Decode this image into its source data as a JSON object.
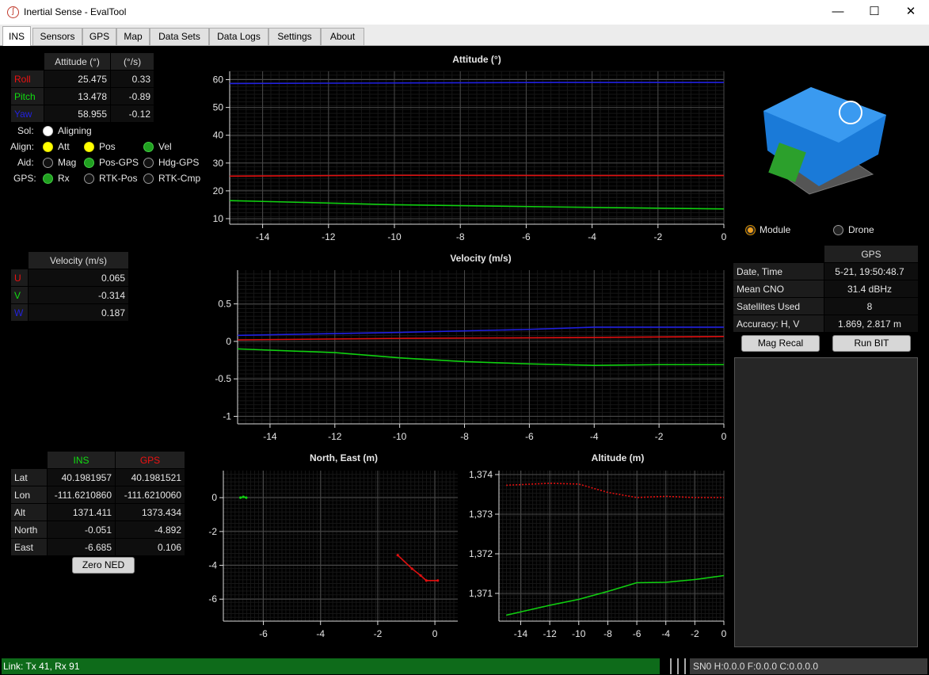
{
  "window": {
    "title": "Inertial Sense - EvalTool",
    "minimize": "—",
    "maximize": "☐",
    "close": "✕"
  },
  "tabs": [
    "INS",
    "Sensors",
    "GPS",
    "Map",
    "Data Sets",
    "Data Logs",
    "Settings",
    "About"
  ],
  "attitude_table": {
    "headers": [
      "Attitude (°)",
      "(°/s)"
    ],
    "rows": [
      {
        "label": "Roll",
        "value": "25.475",
        "rate": "0.33"
      },
      {
        "label": "Pitch",
        "value": "13.478",
        "rate": "-0.89"
      },
      {
        "label": "Yaw",
        "value": "58.955",
        "rate": "-0.12"
      }
    ]
  },
  "indicators": {
    "sol_label": "Sol:",
    "sol_text": "Aligning",
    "align_label": "Align:",
    "align_att": "Att",
    "align_pos": "Pos",
    "align_vel": "Vel",
    "aid_label": "Aid:",
    "aid_mag": "Mag",
    "aid_posgps": "Pos-GPS",
    "aid_hdggps": "Hdg-GPS",
    "gps_label": "GPS:",
    "gps_rx": "Rx",
    "gps_rtkpos": "RTK-Pos",
    "gps_rtkcmp": "RTK-Cmp"
  },
  "velocity_table": {
    "header": "Velocity (m/s)",
    "rows": [
      {
        "label": "U",
        "value": "0.065"
      },
      {
        "label": "V",
        "value": "-0.314"
      },
      {
        "label": "W",
        "value": "0.187"
      }
    ]
  },
  "position_table": {
    "headers": [
      "INS",
      "GPS"
    ],
    "rows": [
      {
        "label": "Lat",
        "ins": "40.1981957",
        "gps": "40.1981521"
      },
      {
        "label": "Lon",
        "ins": "-111.6210860",
        "gps": "-111.6210060"
      },
      {
        "label": "Alt",
        "ins": "1371.411",
        "gps": "1373.434"
      },
      {
        "label": "North",
        "ins": "-0.051",
        "gps": "-4.892"
      },
      {
        "label": "East",
        "ins": "-6.685",
        "gps": "0.106"
      }
    ]
  },
  "zero_ned_label": "Zero NED",
  "model_radio": {
    "module": "Module",
    "drone": "Drone"
  },
  "gps_table": {
    "header": "GPS",
    "rows": [
      {
        "label": "Date, Time",
        "value": "5-21, 19:50:48.7"
      },
      {
        "label": "Mean CNO",
        "value": "31.4 dBHz"
      },
      {
        "label": "Satellites Used",
        "value": "8"
      },
      {
        "label": "Accuracy: H, V",
        "value": "1.869, 2.817 m"
      }
    ]
  },
  "mag_recal_label": "Mag Recal",
  "run_bit_label": "Run BIT",
  "status": {
    "link": "Link: Tx 41, Rx 91",
    "sn": "SN0 H:0.0.0  F:0.0.0  C:0.0.0.0"
  },
  "colors": {
    "roll": "#e01010",
    "pitch": "#10d010",
    "yaw": "#2020e0",
    "ins": "#10d010",
    "gps": "#e01010"
  },
  "chart_data": [
    {
      "type": "line",
      "title": "Attitude (°)",
      "xlim": [
        -15,
        0
      ],
      "ylim": [
        8,
        63
      ],
      "xticks": [
        -14,
        -12,
        -10,
        -8,
        -6,
        -4,
        -2,
        0
      ],
      "yticks": [
        10,
        20,
        30,
        40,
        50,
        60
      ],
      "series": [
        {
          "name": "Roll",
          "x": [
            -15,
            -10,
            -5,
            0
          ],
          "values": [
            25.3,
            25.6,
            25.5,
            25.5
          ]
        },
        {
          "name": "Pitch",
          "x": [
            -15,
            -10,
            -5,
            0
          ],
          "values": [
            16.5,
            15,
            14.2,
            13.5
          ]
        },
        {
          "name": "Yaw",
          "x": [
            -15,
            -10,
            -5,
            0
          ],
          "values": [
            58.6,
            58.8,
            59,
            59
          ]
        }
      ]
    },
    {
      "type": "line",
      "title": "Velocity (m/s)",
      "xlim": [
        -15,
        0
      ],
      "ylim": [
        -1.1,
        0.95
      ],
      "xticks": [
        -14,
        -12,
        -10,
        -8,
        -6,
        -4,
        -2,
        0
      ],
      "yticks": [
        -1,
        -0.5,
        0,
        0.5
      ],
      "series": [
        {
          "name": "U",
          "x": [
            -15,
            -10,
            -5,
            0
          ],
          "values": [
            0.02,
            0.04,
            0.05,
            0.065
          ]
        },
        {
          "name": "V",
          "x": [
            -15,
            -12,
            -10,
            -8,
            -6,
            -4,
            -2,
            0
          ],
          "values": [
            -0.1,
            -0.15,
            -0.22,
            -0.27,
            -0.3,
            -0.32,
            -0.31,
            -0.31
          ]
        },
        {
          "name": "W",
          "x": [
            -15,
            -10,
            -6,
            -4,
            0
          ],
          "values": [
            0.08,
            0.12,
            0.16,
            0.19,
            0.19
          ]
        }
      ]
    },
    {
      "type": "scatter",
      "title": "North, East (m)",
      "xlim": [
        -7.4,
        0.8
      ],
      "ylim": [
        -7.3,
        1.6
      ],
      "xticks": [
        -6,
        -4,
        -2,
        0
      ],
      "yticks": [
        -6,
        -4,
        -2,
        0
      ],
      "series": [
        {
          "name": "INS",
          "x": [
            -6.8,
            -6.7,
            -6.6
          ],
          "values": [
            0,
            0.05,
            0
          ]
        },
        {
          "name": "GPS",
          "x": [
            -1.3,
            -0.8,
            -0.5,
            -0.3,
            0.1
          ],
          "values": [
            -3.4,
            -4.2,
            -4.6,
            -4.9,
            -4.9
          ]
        }
      ]
    },
    {
      "type": "line",
      "title": "Altitude (m)",
      "xlim": [
        -15.5,
        0
      ],
      "ylim": [
        1370.3,
        1374.1
      ],
      "xticks": [
        -14,
        -12,
        -10,
        -8,
        -6,
        -4,
        -2,
        0
      ],
      "yticks": [
        1371,
        1372,
        1373,
        1374
      ],
      "yticklabels": [
        "1,371",
        "1,372",
        "1,373",
        "1,374"
      ],
      "series": [
        {
          "name": "GPS",
          "x": [
            -15,
            -12,
            -10,
            -8,
            -6,
            -4,
            -2,
            0
          ],
          "values": [
            1373.73,
            1373.78,
            1373.76,
            1373.55,
            1373.42,
            1373.45,
            1373.42,
            1373.42
          ]
        },
        {
          "name": "INS",
          "x": [
            -15,
            -12,
            -10,
            -8,
            -6,
            -4,
            -2,
            0
          ],
          "values": [
            1370.45,
            1370.7,
            1370.85,
            1371.05,
            1371.27,
            1371.28,
            1371.35,
            1371.45
          ]
        }
      ]
    }
  ]
}
